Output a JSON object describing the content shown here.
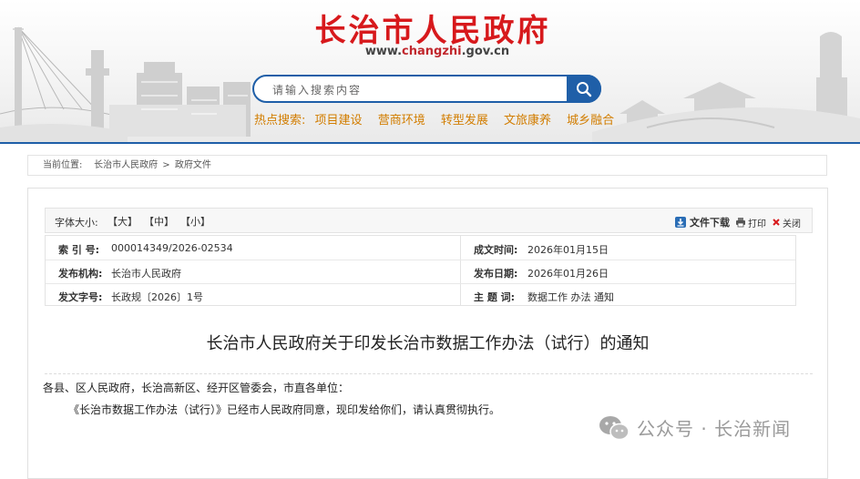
{
  "header": {
    "site_title": "长治市人民政府",
    "url_prefix": "www.",
    "url_highlight": "changzhi",
    "url_suffix": ".gov.cn",
    "search_placeholder": "请输入搜索内容",
    "search_icon": "search-icon",
    "hot_label": "热点搜索:",
    "hot_items": [
      "项目建设",
      "营商环境",
      "转型发展",
      "文旅康养",
      "城乡融合"
    ]
  },
  "breadcrumb": {
    "label": "当前位置:",
    "items": [
      "长治市人民政府",
      "政府文件"
    ],
    "separator": ">"
  },
  "toolbar": {
    "font_size_label": "字体大小:",
    "large": "【大】",
    "medium": "【中】",
    "small": "【小】",
    "download": "文件下载",
    "print": "打印",
    "close": "关闭"
  },
  "meta": {
    "index_label": "索 引 号:",
    "index_value": "000014349/2026-02534",
    "created_label": "成文时间:",
    "created_value": "2026年01月15日",
    "org_label": "发布机构:",
    "org_value": "长治市人民政府",
    "publish_label": "发布日期:",
    "publish_value": "2026年01月26日",
    "docno_label": "发文字号:",
    "docno_value": "长政规〔2026〕1号",
    "topic_label": "主 题 词:",
    "topic_value": "数据工作 办法 通知"
  },
  "document": {
    "title": "长治市人民政府关于印发长治市数据工作办法（试行）的通知",
    "greeting": "各县、区人民政府，长治高新区、经开区管委会，市直各单位：",
    "paragraph": "《长治市数据工作办法（试行）》已经市人民政府同意，现印发给你们，请认真贯彻执行。"
  },
  "watermark": {
    "text": "公众号 · 长治新闻",
    "icon": "wechat-icon"
  },
  "colors": {
    "title_red": "#d7191c",
    "accent_blue": "#1f5fa8",
    "hot_orange": "#d27d00"
  }
}
